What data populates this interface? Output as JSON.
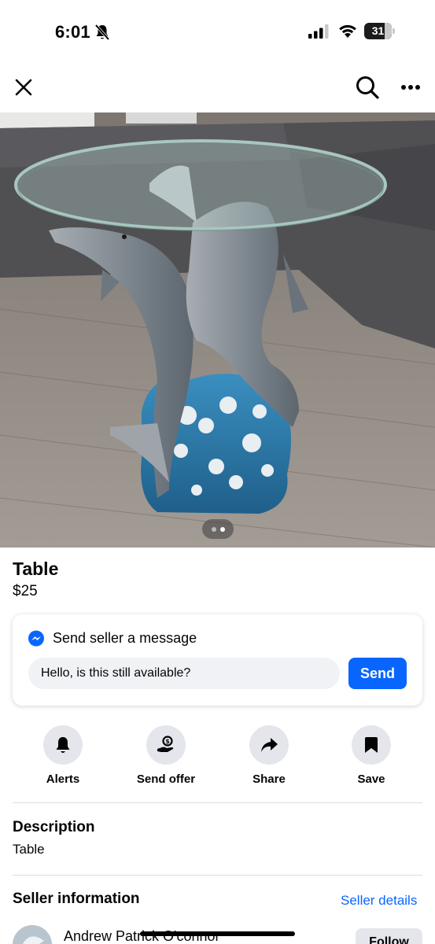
{
  "status_bar": {
    "time": "6:01",
    "battery": "31",
    "icons": [
      "bell-slash-icon",
      "cellular-signal-icon",
      "wifi-icon",
      "battery-icon"
    ]
  },
  "nav": {
    "icons": [
      "close-icon",
      "search-icon",
      "more-icon"
    ]
  },
  "photo": {
    "page_count": 2,
    "current_page": 1,
    "colors": {
      "floor": "#8f8780",
      "sofa": "#4f4e50",
      "water": "#2b79a8",
      "dolphin": "#8c959c"
    }
  },
  "listing": {
    "title": "Table",
    "price": "$25"
  },
  "message": {
    "heading": "Send seller a message",
    "input_value": "Hello, is this still available?",
    "send_label": "Send",
    "icon": "messenger-icon"
  },
  "actions": [
    {
      "label": "Alerts",
      "icon": "bell-icon"
    },
    {
      "label": "Send offer",
      "icon": "send-offer-icon"
    },
    {
      "label": "Share",
      "icon": "share-icon"
    },
    {
      "label": "Save",
      "icon": "bookmark-icon"
    }
  ],
  "description": {
    "heading": "Description",
    "text": "Table"
  },
  "seller": {
    "heading": "Seller information",
    "details_link": "Seller details",
    "name": "Andrew Patrick O'connor",
    "follow_label": "Follow"
  },
  "colors": {
    "accent": "#0866ff",
    "action_bg": "#e4e6eb",
    "input_bg": "#f0f2f5",
    "divider": "#dadde1"
  }
}
